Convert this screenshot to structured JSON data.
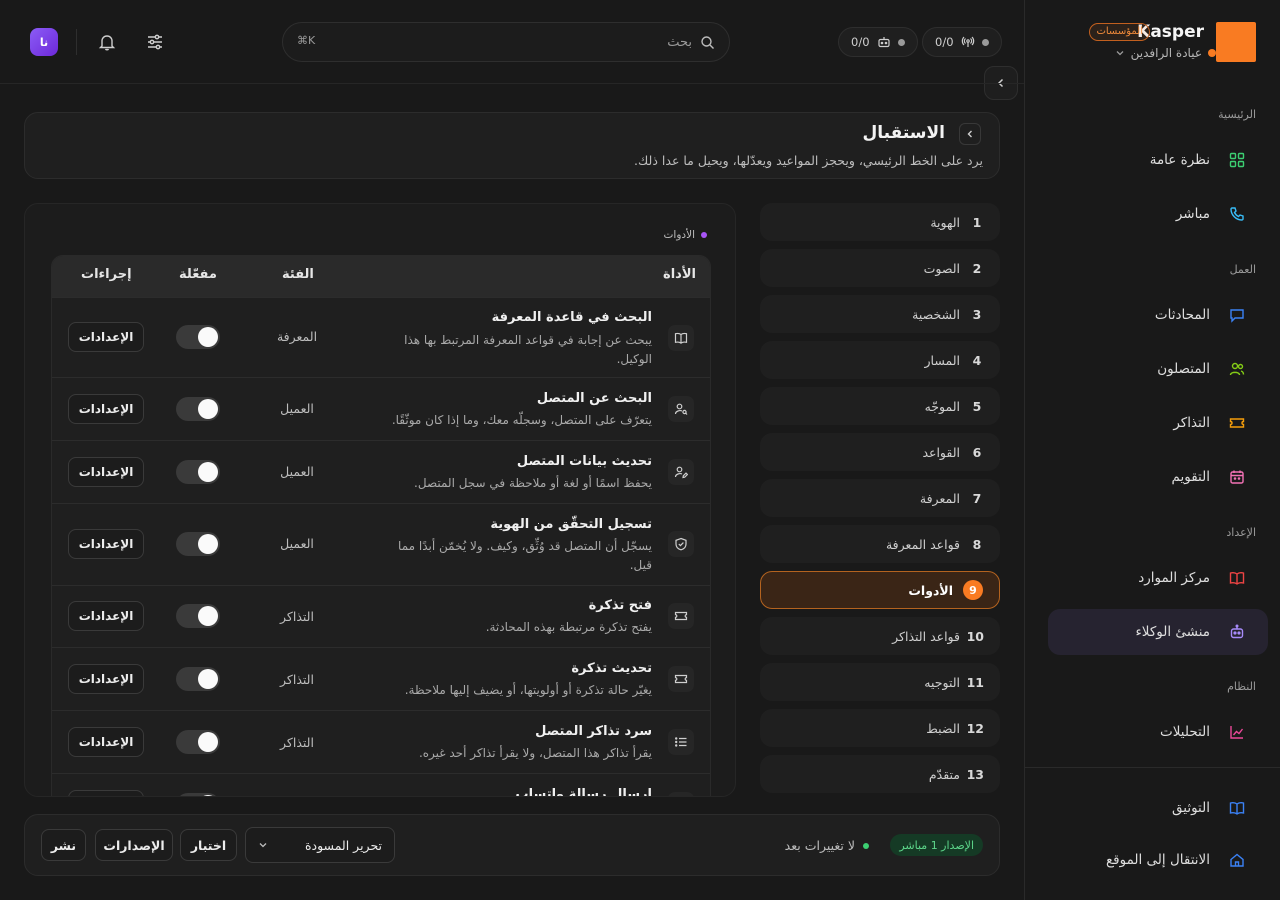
{
  "brand": {
    "name": "Kasper",
    "badge": "المؤسسات",
    "org": "عيادة الرافدين"
  },
  "topbar": {
    "stat1": "0/0",
    "stat2": "0/0",
    "search_placeholder": "بحث",
    "search_shortcut": "⌘K",
    "avatar_initials": "نا"
  },
  "sidebar": {
    "sections": {
      "main": "الرئيسية",
      "work": "العمل",
      "setup": "الإعداد",
      "system": "النظام"
    },
    "items": {
      "overview": "نظرة عامة",
      "live": "مباشر",
      "conversations": "المحادثات",
      "contacts": "المتصلون",
      "tickets": "التذاكر",
      "calendar": "التقويم",
      "resources": "مركز الموارد",
      "agent_builder": "منشئ الوكلاء",
      "analytics": "التحليلات",
      "docs": "التوثيق",
      "goto_site": "الانتقال إلى الموقع"
    }
  },
  "header": {
    "title": "الاستقبال",
    "subtitle": "يرد على الخط الرئيسي، ويحجز المواعيد ويعدّلها، ويحيل ما عدا ذلك."
  },
  "steps": [
    {
      "num": "1",
      "label": "الهوية"
    },
    {
      "num": "2",
      "label": "الصوت"
    },
    {
      "num": "3",
      "label": "الشخصية"
    },
    {
      "num": "4",
      "label": "المسار"
    },
    {
      "num": "5",
      "label": "الموجّه"
    },
    {
      "num": "6",
      "label": "القواعد"
    },
    {
      "num": "7",
      "label": "المعرفة"
    },
    {
      "num": "8",
      "label": "قواعد المعرفة"
    },
    {
      "num": "9",
      "label": "الأدوات"
    },
    {
      "num": "10",
      "label": "قواعد التذاكر"
    },
    {
      "num": "11",
      "label": "التوجيه"
    },
    {
      "num": "12",
      "label": "الضبط"
    },
    {
      "num": "13",
      "label": "متقدّم"
    }
  ],
  "active_step": 9,
  "tools": {
    "tag": "الأدوات",
    "columns": {
      "tool": "الأداة",
      "category": "الفئة",
      "enabled": "مفعّلة",
      "actions": "إجراءات"
    },
    "settings_label": "الإعدادات",
    "rows": [
      {
        "icon": "book-icon",
        "name": "البحث في قاعدة المعرفة",
        "desc": "يبحث عن إجابة في قواعد المعرفة المرتبط بها هذا الوكيل.",
        "category": "المعرفة",
        "enabled": true
      },
      {
        "icon": "user-search-icon",
        "name": "البحث عن المتصل",
        "desc": "يتعرّف على المتصل، وسجلّه معك، وما إذا كان موثّقًا.",
        "category": "العميل",
        "enabled": true
      },
      {
        "icon": "user-edit-icon",
        "name": "تحديث بيانات المتصل",
        "desc": "يحفظ اسمًا أو لغة أو ملاحظة في سجل المتصل.",
        "category": "العميل",
        "enabled": true
      },
      {
        "icon": "shield-icon",
        "name": "تسجيل التحقّق من الهوية",
        "desc": "يسجّل أن المتصل قد وُثِّق، وكيف. ولا يُخمّن أبدًا مما قيل.",
        "category": "العميل",
        "enabled": true
      },
      {
        "icon": "ticket-icon",
        "name": "فتح تذكرة",
        "desc": "يفتح تذكرة مرتبطة بهذه المحادثة.",
        "category": "التذاكر",
        "enabled": true
      },
      {
        "icon": "ticket-icon",
        "name": "تحديث تذكرة",
        "desc": "يغيّر حالة تذكرة أو أولويتها، أو يضيف إليها ملاحظة.",
        "category": "التذاكر",
        "enabled": true
      },
      {
        "icon": "list-icon",
        "name": "سرد تذاكر المتصل",
        "desc": "يقرأ تذاكر هذا المتصل، ولا يقرأ تذاكر أحد غيره.",
        "category": "التذاكر",
        "enabled": true
      },
      {
        "icon": "message-icon",
        "name": "إرسال رسالة واتساب",
        "desc": "",
        "category": "",
        "enabled": true
      }
    ]
  },
  "bottom": {
    "live_badge": "الإصدار 1 مباشر",
    "no_changes": "لا تغييرات بعد",
    "draft_select": "تحرير المسودة",
    "test": "اختبار",
    "versions": "الإصدارات",
    "publish": "نشر"
  }
}
